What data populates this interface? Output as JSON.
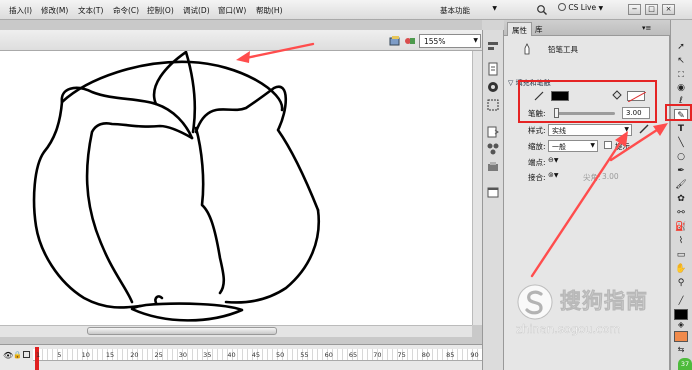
{
  "menu": {
    "items": [
      "插入(I)",
      "修改(M)",
      "文本(T)",
      "命令(C)",
      "控制(O)",
      "调试(D)",
      "窗口(W)",
      "帮助(H)"
    ],
    "workspace": "基本功能",
    "cs_live": "CS Live",
    "window_controls": [
      "−",
      "□",
      "×"
    ]
  },
  "stage": {
    "zoom": "155%"
  },
  "timeline": {
    "frame_numbers": [
      "1",
      "5",
      "10",
      "15",
      "20",
      "25",
      "30",
      "35",
      "40",
      "45",
      "50",
      "55",
      "60",
      "65",
      "70",
      "75",
      "80",
      "85",
      "90"
    ]
  },
  "properties": {
    "tabs": [
      "属性",
      "库"
    ],
    "tool_name": "铅笔工具",
    "section_fill_stroke": "填充和笔触",
    "stroke_label": "笔触:",
    "stroke_value": "3.00",
    "stroke_level": 0.03,
    "style_label": "样式:",
    "style_value": "实线",
    "scale_label": "缩放:",
    "scale_value": "一般",
    "hint_label": "提示",
    "cap_label": "端点:",
    "join_label": "接合:",
    "miter_label": "尖角:",
    "miter_value": "3.00"
  },
  "colors": {
    "stroke_color": "#000000",
    "fill_color": "#ffffff",
    "highlight": "#e52424",
    "arrow": "#ff4d4d"
  },
  "watermark": {
    "text": "搜狗指南",
    "url": "zhinan.sogou.com"
  },
  "ext_badge": "37"
}
